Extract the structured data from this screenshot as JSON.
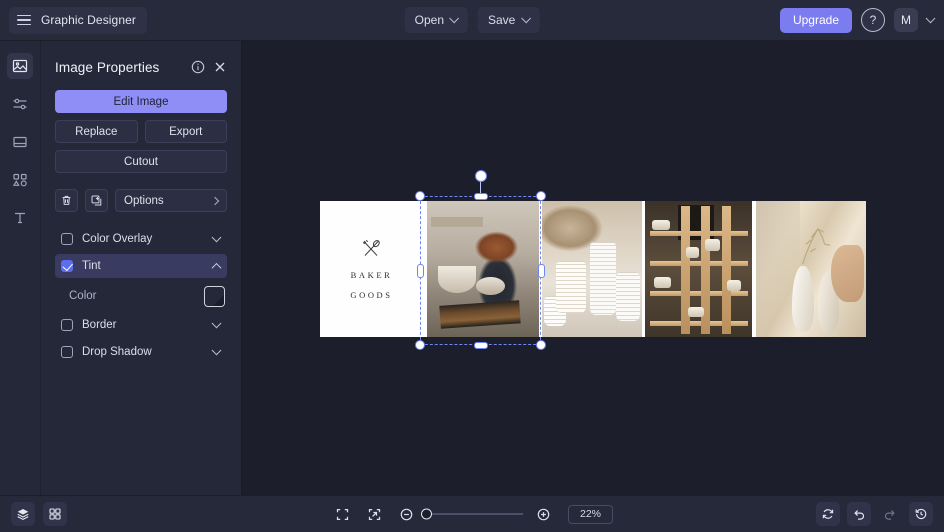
{
  "topbar": {
    "brand_label": "Graphic Designer",
    "menu_icon": "hamburger-icon",
    "open_label": "Open",
    "save_label": "Save",
    "upgrade_label": "Upgrade",
    "help_icon": "question-mark-icon",
    "avatar_initial": "M",
    "accent_color": "#7b7cf0"
  },
  "rail": {
    "items": [
      {
        "name": "image-tool",
        "icon": "image-icon",
        "active": true
      },
      {
        "name": "adjust-tool",
        "icon": "sliders-icon",
        "active": false
      },
      {
        "name": "layout-tool",
        "icon": "layout-icon",
        "active": false
      },
      {
        "name": "shapes-tool",
        "icon": "shapes-icon",
        "active": false
      },
      {
        "name": "text-tool",
        "icon": "text-t-icon",
        "active": false
      }
    ]
  },
  "panel": {
    "title": "Image Properties",
    "info_icon": "info-circle-icon",
    "close_icon": "close-x-icon",
    "edit_image_label": "Edit Image",
    "replace_label": "Replace",
    "export_label": "Export",
    "cutout_label": "Cutout",
    "delete_icon": "trash-icon",
    "duplicate_icon": "duplicate-icon",
    "options_label": "Options",
    "options_chevron": "chevron-right-icon",
    "primary_color": "#8e8ef6",
    "effects": [
      {
        "label": "Color Overlay",
        "checked": false,
        "expanded": false,
        "chevron": "chevron-down-icon"
      },
      {
        "label": "Tint",
        "checked": true,
        "expanded": true,
        "chevron": "chevron-up-icon"
      },
      {
        "label": "Border",
        "checked": false,
        "expanded": false,
        "chevron": "chevron-down-icon"
      },
      {
        "label": "Drop Shadow",
        "checked": false,
        "expanded": false,
        "chevron": "chevron-down-icon"
      }
    ],
    "tint_color_label": "Color",
    "tint_color_value": "#f7e8cd"
  },
  "canvas": {
    "logo_line1": "BAKER",
    "logo_line2": "GOODS",
    "logo_icon": "crossed-spoon-fork-icon",
    "cells": [
      {
        "name": "logo-panel",
        "caption": "Baker Goods logo on white"
      },
      {
        "name": "potter-photo",
        "caption": "Potter shaping clay at wheel",
        "selected": true
      },
      {
        "name": "bowls-photo",
        "caption": "Stacked white ceramic bowls"
      },
      {
        "name": "shelving-photo",
        "caption": "Wooden shelving with pottery"
      },
      {
        "name": "vase-photo",
        "caption": "Hand reaching toward vase with dried flowers"
      }
    ],
    "selection_color": "#6f86f5"
  },
  "bottombar": {
    "layers_icon": "layers-icon",
    "grid_icon": "grid-icon",
    "fit_screen_icon": "fit-screen-icon",
    "fit_selection_icon": "fit-selection-icon",
    "zoom_out_icon": "zoom-out-icon",
    "zoom_in_icon": "zoom-in-icon",
    "zoom_level": "22%",
    "reset_icon": "reset-icon",
    "undo_icon": "undo-icon",
    "redo_icon": "redo-icon",
    "history_icon": "history-icon"
  }
}
